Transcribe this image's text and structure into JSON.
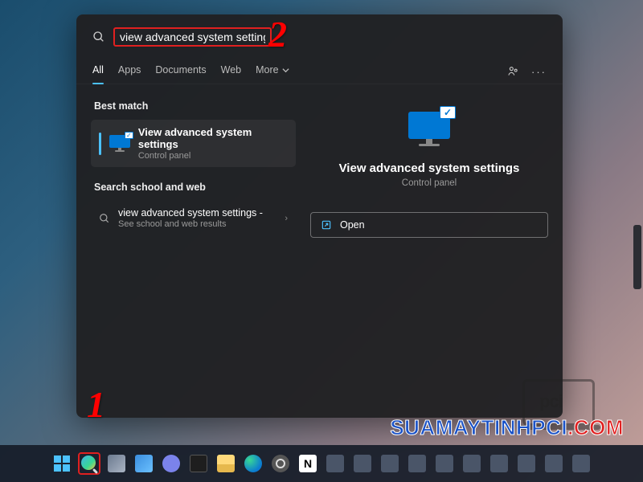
{
  "search": {
    "query": "view advanced system settings"
  },
  "tabs": {
    "all": "All",
    "apps": "Apps",
    "documents": "Documents",
    "web": "Web",
    "more": "More"
  },
  "sections": {
    "best_match": "Best match",
    "school_web": "Search school and web"
  },
  "best_match_result": {
    "title": "View advanced system settings",
    "subtitle": "Control panel"
  },
  "web_result": {
    "title": "view advanced system settings -",
    "subtitle": "See school and web results"
  },
  "preview": {
    "title": "View advanced system settings",
    "subtitle": "Control panel",
    "actions": {
      "open": "Open"
    }
  },
  "annotations": {
    "one": "1",
    "two": "2"
  },
  "watermark": {
    "logo_text": "pci",
    "url_part1": "SUAMAYTINHPCI",
    "url_part2": ".COM"
  },
  "taskbar": {
    "notion_letter": "N"
  }
}
